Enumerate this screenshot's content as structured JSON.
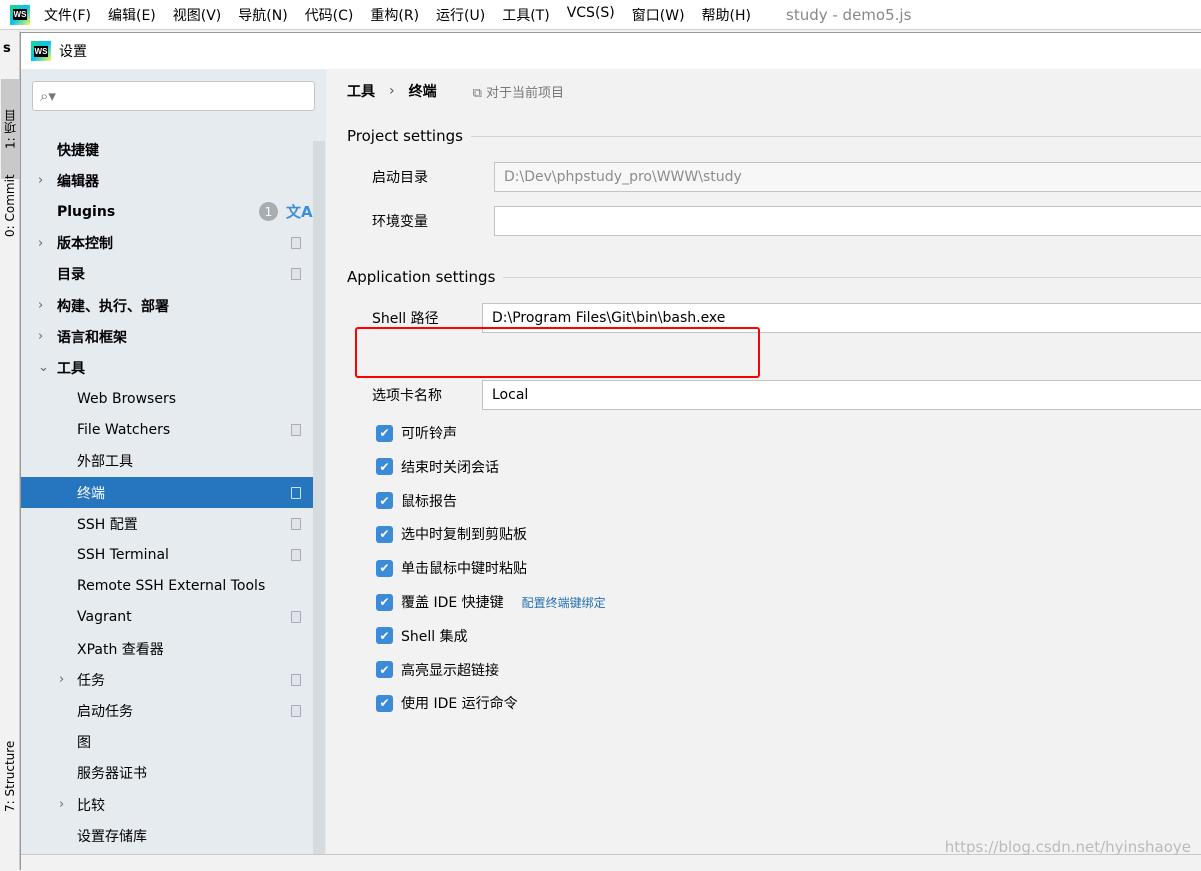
{
  "menubar": {
    "items": [
      "文件(F)",
      "编辑(E)",
      "视图(V)",
      "导航(N)",
      "代码(C)",
      "重构(R)",
      "运行(U)",
      "工具(T)",
      "VCS(S)",
      "窗口(W)",
      "帮助(H)"
    ],
    "window_title": "study - demo5.js",
    "logo_text": "WS"
  },
  "ide_left": {
    "project_initial": "s",
    "tabs": [
      "1: 项目",
      "0: Commit",
      "7: Structure"
    ]
  },
  "dialog": {
    "title": "设置"
  },
  "sidebar": {
    "search_placeholder": "",
    "items": [
      {
        "label": "快捷键",
        "level": 0
      },
      {
        "label": "编辑器",
        "level": 0,
        "arrow": "›"
      },
      {
        "label": "Plugins",
        "level": 0,
        "badge": "1",
        "translate": "文A"
      },
      {
        "label": "版本控制",
        "level": 0,
        "arrow": "›",
        "copy": true
      },
      {
        "label": "目录",
        "level": 0,
        "copy": true
      },
      {
        "label": "构建、执行、部署",
        "level": 0,
        "arrow": "›"
      },
      {
        "label": "语言和框架",
        "level": 0,
        "arrow": "›"
      },
      {
        "label": "工具",
        "level": 0,
        "arrow": "⌄"
      },
      {
        "label": "Web Browsers",
        "level": 1
      },
      {
        "label": "File Watchers",
        "level": 1,
        "copy": true
      },
      {
        "label": "外部工具",
        "level": 1
      },
      {
        "label": "终端",
        "level": 1,
        "copy": true,
        "selected": true
      },
      {
        "label": "SSH 配置",
        "level": 1,
        "copy": true
      },
      {
        "label": "SSH Terminal",
        "level": 1,
        "copy": true
      },
      {
        "label": "Remote SSH External Tools",
        "level": 1
      },
      {
        "label": "Vagrant",
        "level": 1,
        "copy": true
      },
      {
        "label": "XPath 查看器",
        "level": 1
      },
      {
        "label": "任务",
        "level": 1,
        "arrow": "›",
        "copy": true
      },
      {
        "label": "启动任务",
        "level": 1,
        "copy": true
      },
      {
        "label": "图",
        "level": 1
      },
      {
        "label": "服务器证书",
        "level": 1
      },
      {
        "label": "比较",
        "level": 1,
        "arrow": "›"
      },
      {
        "label": "设置存储库",
        "level": 1
      }
    ]
  },
  "breadcrumb": {
    "parent": "工具",
    "current": "终端",
    "scope": "对于当前项目"
  },
  "project_settings": {
    "title": "Project settings",
    "start_dir_label": "启动目录",
    "start_dir_value": "D:\\Dev\\phpstudy_pro\\WWW\\study",
    "env_label": "环境变量",
    "env_value": ""
  },
  "application_settings": {
    "title": "Application settings",
    "shell_label": "Shell 路径",
    "shell_value": "D:\\Program Files\\Git\\bin\\bash.exe",
    "tab_name_label": "选项卡名称",
    "tab_name_value": "Local",
    "checkboxes": [
      {
        "label": "可听铃声",
        "checked": true
      },
      {
        "label": "结束时关闭会话",
        "checked": true
      },
      {
        "label": "鼠标报告",
        "checked": true
      },
      {
        "label": "选中时复制到剪贴板",
        "checked": true
      },
      {
        "label": "单击鼠标中键时粘贴",
        "checked": true
      },
      {
        "label": "覆盖 IDE 快捷键",
        "checked": true,
        "link": "配置终端键绑定"
      },
      {
        "label": "Shell 集成",
        "checked": true
      },
      {
        "label": "高亮显示超链接",
        "checked": true
      },
      {
        "label": "使用 IDE 运行命令",
        "checked": true
      }
    ]
  },
  "highlight_color": "#ff0000",
  "accent_color": "#2675bf",
  "watermark": "https://blog.csdn.net/hyinshaoye"
}
